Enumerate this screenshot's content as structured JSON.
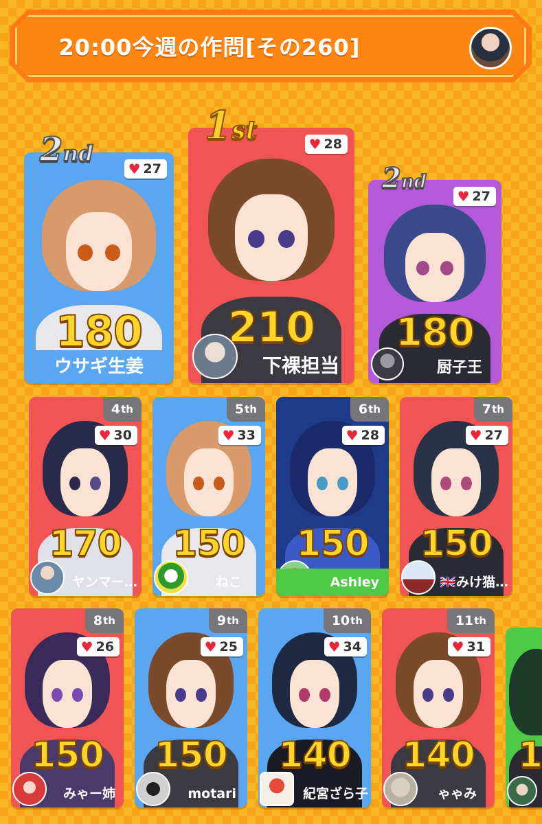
{
  "header": {
    "title": "20:00今週の作問[その260]",
    "avatar_icon": "user-avatar-icon"
  },
  "colors": {
    "blue": "#5aa6f0",
    "red": "#f05454",
    "purple": "#b45ad8",
    "green": "#4fc946",
    "score_gold": "#ffd52a",
    "background": "#f6a417",
    "header": "#fb8612"
  },
  "top3": [
    {
      "place": "2",
      "place_suffix": "nd",
      "likes": "27",
      "score": "180",
      "name": "ウサギ生姜",
      "color": "blue"
    },
    {
      "place": "1",
      "place_suffix": "st",
      "likes": "28",
      "score": "210",
      "name": "下裸担当",
      "color": "red"
    },
    {
      "place": "2",
      "place_suffix": "nd",
      "likes": "27",
      "score": "180",
      "name": "厨子王",
      "color": "purple"
    }
  ],
  "row2": [
    {
      "rank": "4",
      "suffix": "th",
      "likes": "30",
      "score": "170",
      "name": "ヤンマー…",
      "color": "red"
    },
    {
      "rank": "5",
      "suffix": "th",
      "likes": "33",
      "score": "150",
      "name": "ねこ",
      "color": "blue"
    },
    {
      "rank": "6",
      "suffix": "th",
      "likes": "28",
      "score": "150",
      "name": "Ashley",
      "color": "green"
    },
    {
      "rank": "7",
      "suffix": "th",
      "likes": "27",
      "score": "150",
      "name": "🇬🇧みけ猫…",
      "color": "red"
    }
  ],
  "row3": [
    {
      "rank": "8",
      "suffix": "th",
      "likes": "26",
      "score": "150",
      "name": "みゃー姉",
      "color": "red"
    },
    {
      "rank": "9",
      "suffix": "th",
      "likes": "25",
      "score": "150",
      "name": "motari",
      "color": "blue"
    },
    {
      "rank": "10",
      "suffix": "th",
      "likes": "34",
      "score": "140",
      "name": "紀宮ざら子",
      "color": "blue"
    },
    {
      "rank": "11",
      "suffix": "th",
      "likes": "31",
      "score": "140",
      "name": "ゃゃみ",
      "color": "red"
    },
    {
      "rank": "",
      "suffix": "",
      "likes": "",
      "score": "1",
      "name": "",
      "color": "green"
    }
  ]
}
